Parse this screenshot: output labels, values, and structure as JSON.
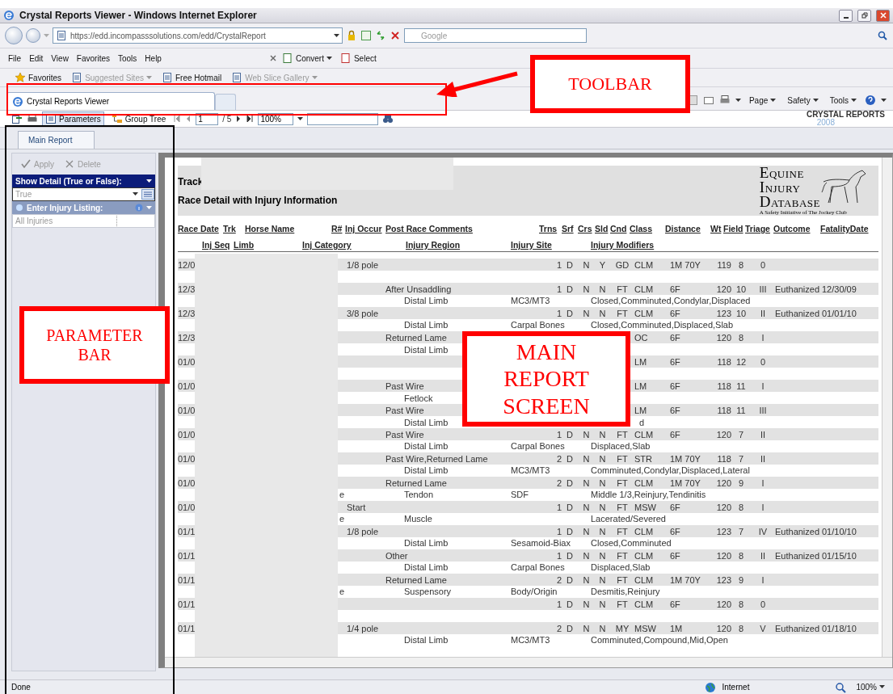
{
  "window": {
    "title": "Crystal Reports Viewer - Windows Internet Explorer"
  },
  "address_bar": {
    "url": "https://edd.incompasssolutions.com/edd/CrystalReport",
    "search_placeholder": "Google"
  },
  "menu": [
    "File",
    "Edit",
    "View",
    "Favorites",
    "Tools",
    "Help"
  ],
  "menu_tools": [
    {
      "label": "Convert",
      "dropdown": true
    },
    {
      "label": "Select",
      "dropdown": false
    }
  ],
  "favorites_bar": [
    {
      "label": "Favorites",
      "dimmed": false,
      "dropdown": false
    },
    {
      "label": "Suggested Sites",
      "dimmed": true,
      "dropdown": true
    },
    {
      "label": "Free Hotmail",
      "dimmed": false,
      "dropdown": false
    },
    {
      "label": "Web Slice Gallery",
      "dimmed": true,
      "dropdown": true
    }
  ],
  "browser_tabs": [
    {
      "label": "Crystal Reports Viewer",
      "selected": true
    }
  ],
  "command_bar": [
    "Page",
    "Safety",
    "Tools"
  ],
  "viewer_toolbar": {
    "buttons": [
      {
        "label": "Parameters",
        "selected": true
      },
      {
        "label": "Group Tree",
        "selected": false
      }
    ],
    "page": "1",
    "page_count": "/ 5",
    "zoom": "100%",
    "brand": "CRYSTAL REPORTS",
    "brand_year": "2008"
  },
  "report_tabs": [
    {
      "label": "Main Report",
      "selected": true
    }
  ],
  "parameter_panel": {
    "actions": [
      {
        "label": "Apply",
        "disabled": true
      },
      {
        "label": "Delete",
        "disabled": true
      }
    ],
    "parameters": [
      {
        "label": "Show Detail (True or False):",
        "value": "True",
        "kind": "select",
        "active": true
      },
      {
        "label": "Enter Injury Listing:",
        "value": "All Injuries",
        "kind": "text",
        "active": false
      }
    ]
  },
  "report": {
    "title": "Track",
    "subtitle": "Race Detail with Injury Information",
    "logo": {
      "lines": [
        "EQUINE",
        "INJURY",
        "DATABASE"
      ],
      "tagline": "A Safety Initiative of The Jockey Club"
    },
    "columns": [
      "Race Date",
      "Trk",
      "Horse Name",
      "R#",
      "Inj Occur",
      "Post Race Comments",
      "Trns",
      "Srf",
      "Crs",
      "Sld",
      "Cnd",
      "Class",
      "Distance",
      "Wt",
      "Field",
      "Triage",
      "Outcome",
      "FatalityDate"
    ],
    "detail_columns": [
      "Inj Seq",
      "Limb",
      "Inj Category",
      "Injury Region",
      "Injury Site",
      "Injury Modifiers"
    ],
    "records": [
      {
        "main": {
          "date": "12/0",
          "occur": "1/8 pole",
          "trns": "1",
          "srf": "D",
          "crs": "N",
          "sld": "Y",
          "cnd": "GD",
          "class": "CLM",
          "distance": "1M 70Y",
          "wt": "119",
          "field": "8",
          "triage": "0"
        }
      },
      {
        "main": {
          "date": "12/3",
          "comments": "After Unsaddling",
          "trns": "1",
          "srf": "D",
          "crs": "N",
          "sld": "N",
          "cnd": "FT",
          "class": "CLM",
          "distance": "6F",
          "wt": "120",
          "field": "10",
          "triage": "III",
          "outcome": "Euthanized",
          "fatality": "12/30/09"
        },
        "detail": {
          "region": "Distal Limb",
          "site": "MC3/MT3",
          "modifiers": "Closed,Comminuted,Condylar,Displaced"
        }
      },
      {
        "main": {
          "date": "12/3",
          "occur": "3/8 pole",
          "trns": "1",
          "srf": "D",
          "crs": "N",
          "sld": "N",
          "cnd": "FT",
          "class": "CLM",
          "distance": "6F",
          "wt": "123",
          "field": "10",
          "triage": "II",
          "outcome": "Euthanized",
          "fatality": "01/01/10"
        },
        "detail": {
          "region": "Distal Limb",
          "site": "Carpal Bones",
          "modifiers": "Closed,Comminuted,Displaced,Slab"
        }
      },
      {
        "main": {
          "date": "12/3",
          "comments": "Returned Lame",
          "class": "OC",
          "distance": "6F",
          "wt": "120",
          "field": "8",
          "triage": "I"
        },
        "detail": {
          "region": "Distal Limb"
        }
      },
      {
        "main": {
          "date": "01/0",
          "class": "LM",
          "distance": "6F",
          "wt": "118",
          "field": "12",
          "triage": "0"
        }
      },
      {
        "main": {
          "date": "01/0",
          "comments": "Past Wire",
          "class": "LM",
          "distance": "6F",
          "wt": "118",
          "field": "11",
          "triage": "I"
        },
        "detail": {
          "region": "Fetlock"
        }
      },
      {
        "main": {
          "date": "01/0",
          "comments": "Past Wire",
          "class": "LM",
          "distance": "6F",
          "wt": "118",
          "field": "11",
          "triage": "III"
        },
        "detail": {
          "region": "Distal Limb",
          "modifiers_tail": "d"
        }
      },
      {
        "main": {
          "date": "01/0",
          "comments": "Past Wire",
          "trns": "1",
          "srf": "D",
          "crs": "N",
          "sld": "N",
          "cnd": "FT",
          "class": "CLM",
          "distance": "6F",
          "wt": "120",
          "field": "7",
          "triage": "II"
        },
        "detail": {
          "region": "Distal Limb",
          "site": "Carpal Bones",
          "modifiers": "Displaced,Slab"
        }
      },
      {
        "main": {
          "date": "01/0",
          "comments": "Past Wire,Returned Lame",
          "trns": "2",
          "srf": "D",
          "crs": "N",
          "sld": "N",
          "cnd": "FT",
          "class": "STR",
          "distance": "1M 70Y",
          "wt": "118",
          "field": "7",
          "triage": "II"
        },
        "detail": {
          "region": "Distal Limb",
          "site": "MC3/MT3",
          "modifiers": "Comminuted,Condylar,Displaced,Lateral"
        }
      },
      {
        "main": {
          "date": "01/0",
          "comments": "Returned Lame",
          "trns": "2",
          "srf": "D",
          "crs": "N",
          "sld": "N",
          "cnd": "FT",
          "class": "CLM",
          "distance": "1M 70Y",
          "wt": "120",
          "field": "9",
          "triage": "I"
        },
        "detail": {
          "category": "e",
          "region": "Tendon",
          "site": "SDF",
          "modifiers": "Middle 1/3,Reinjury,Tendinitis"
        }
      },
      {
        "main": {
          "date": "01/0",
          "occur": "Start",
          "trns": "1",
          "srf": "D",
          "crs": "N",
          "sld": "N",
          "cnd": "FT",
          "class": "MSW",
          "distance": "6F",
          "wt": "120",
          "field": "8",
          "triage": "I"
        },
        "detail": {
          "category": "e",
          "region": "Muscle",
          "modifiers": "Lacerated/Severed"
        }
      },
      {
        "main": {
          "date": "01/1",
          "occur": "1/8 pole",
          "trns": "1",
          "srf": "D",
          "crs": "N",
          "sld": "N",
          "cnd": "FT",
          "class": "CLM",
          "distance": "6F",
          "wt": "123",
          "field": "7",
          "triage": "IV",
          "outcome": "Euthanized",
          "fatality": "01/10/10"
        },
        "detail": {
          "region": "Distal Limb",
          "site": "Sesamoid-Biax",
          "modifiers": "Closed,Comminuted"
        }
      },
      {
        "main": {
          "date": "01/1",
          "comments": "Other",
          "trns": "1",
          "srf": "D",
          "crs": "N",
          "sld": "N",
          "cnd": "FT",
          "class": "CLM",
          "distance": "6F",
          "wt": "120",
          "field": "8",
          "triage": "II",
          "outcome": "Euthanized",
          "fatality": "01/15/10"
        },
        "detail": {
          "region": "Distal Limb",
          "site": "Carpal Bones",
          "modifiers": "Displaced,Slab"
        }
      },
      {
        "main": {
          "date": "01/1",
          "comments": "Returned Lame",
          "trns": "2",
          "srf": "D",
          "crs": "N",
          "sld": "N",
          "cnd": "FT",
          "class": "CLM",
          "distance": "1M 70Y",
          "wt": "123",
          "field": "9",
          "triage": "I"
        },
        "detail": {
          "category": "e",
          "region": "Suspensory",
          "site": "Body/Origin",
          "modifiers": "Desmitis,Reinjury"
        }
      },
      {
        "main": {
          "date": "01/1",
          "trns": "1",
          "srf": "D",
          "crs": "N",
          "sld": "N",
          "cnd": "FT",
          "class": "CLM",
          "distance": "6F",
          "wt": "120",
          "field": "8",
          "triage": "0"
        }
      },
      {
        "main": {
          "date": "01/1",
          "occur": "1/4 pole",
          "trns": "2",
          "srf": "D",
          "crs": "N",
          "sld": "N",
          "cnd": "MY",
          "class": "MSW",
          "distance": "1M",
          "wt": "120",
          "field": "8",
          "triage": "V",
          "outcome": "Euthanized",
          "fatality": "01/18/10"
        },
        "detail": {
          "region": "Distal Limb",
          "site": "MC3/MT3",
          "modifiers": "Comminuted,Compound,Mid,Open"
        }
      }
    ]
  },
  "status_bar": {
    "text": "Done",
    "zone": "Internet",
    "zoom": "100%"
  },
  "annotations": {
    "toolbar_label": "TOOLBAR",
    "parameter_label": "PARAMETER BAR",
    "report_label": "MAIN REPORT SCREEN"
  }
}
